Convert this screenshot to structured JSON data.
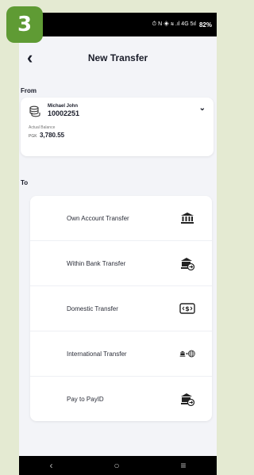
{
  "step_badge": "3",
  "status_bar": {
    "icons_text": "⏱ N ◈ ≋ .ıl 4G 5ıl",
    "battery": "82%"
  },
  "header": {
    "back_icon": "chevron-left-icon",
    "title": "New Transfer"
  },
  "from": {
    "label": "From",
    "account_name": "Michael John",
    "account_number": "10002251",
    "balance_label": "Actual Balance",
    "currency": "PGK",
    "balance": "3,780.55"
  },
  "to": {
    "label": "To",
    "options": [
      {
        "label": "Own Account Transfer",
        "icon": "bank-icon"
      },
      {
        "label": "Within Bank Transfer",
        "icon": "bank-transfer-icon"
      },
      {
        "label": "Domestic Transfer",
        "icon": "currency-exchange-icon"
      },
      {
        "label": "International Transfer",
        "icon": "bank-globe-icon"
      },
      {
        "label": "Pay to PayID",
        "icon": "bank-transfer-icon"
      }
    ]
  },
  "nav": {
    "back": "‹",
    "home": "○",
    "menu": "≡"
  },
  "colors": {
    "accent": "#5f9b34",
    "page_bg": "#e4ead2",
    "text": "#1a1d2a"
  }
}
